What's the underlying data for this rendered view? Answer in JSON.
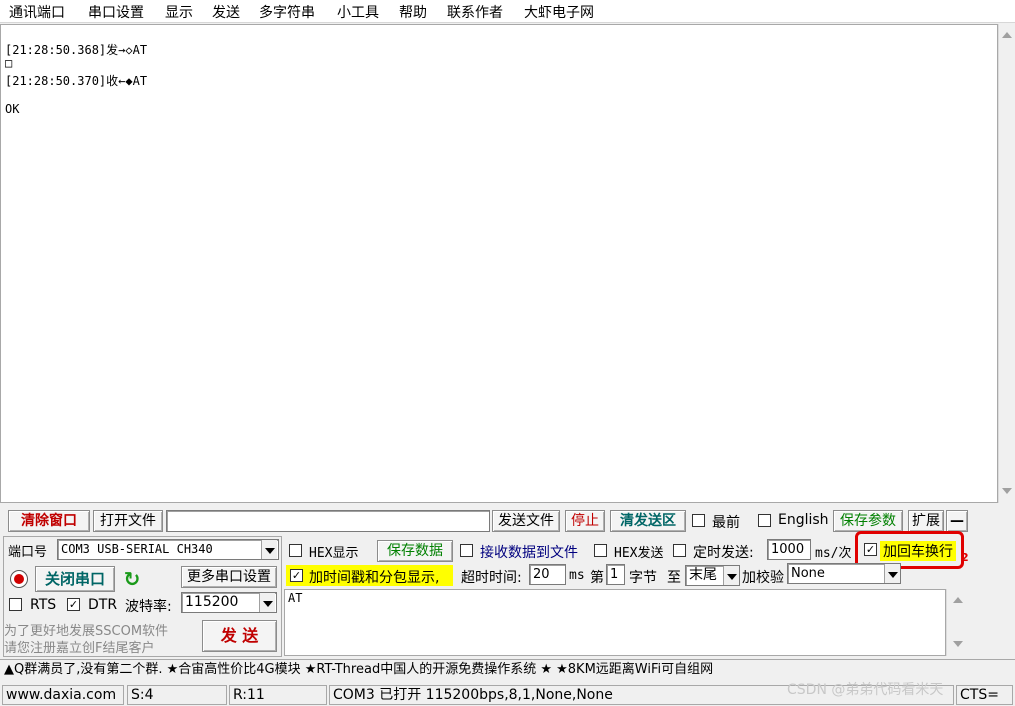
{
  "menu": [
    "通讯端口",
    "串口设置",
    "显示",
    "发送",
    "多字符串",
    "小工具",
    "帮助",
    "联系作者",
    "大虾电子网"
  ],
  "receive": {
    "lines": [
      {
        "text": "[21:28:50.368]发→◇AT"
      },
      {
        "text": "□"
      },
      {
        "text": "[21:28:50.370]收←◆AT"
      },
      {
        "text": ""
      },
      {
        "text": "OK"
      }
    ]
  },
  "toolbar": {
    "clear_window": "清除窗口",
    "open_file": "打开文件",
    "file_path": "",
    "send_file": "发送文件",
    "stop": "停止",
    "clear_send": "清发送区",
    "topmost": "最前",
    "english": "English",
    "save_params": "保存参数",
    "expand": "扩展",
    "collapse": "—"
  },
  "port": {
    "port_label": "端口号",
    "port_value": "COM3 USB-SERIAL CH340",
    "close_port": "关闭串口",
    "more_settings": "更多串口设置",
    "rts": "RTS",
    "dtr": "DTR",
    "baud_label": "波特率:",
    "baud_value": "115200",
    "promo_line1": "为了更好地发展SSCOM软件",
    "promo_line2": "请您注册嘉立创F结尾客户",
    "send_button": "发  送"
  },
  "options": {
    "hex_display": "HEX显示",
    "save_data": "保存数据",
    "recv_to_file": "接收数据到文件",
    "hex_send": "HEX发送",
    "timed_send": "定时发送:",
    "timed_value": "1000",
    "timed_unit": "ms/次",
    "add_crlf": "加回车换行",
    "timestamp": "加时间戳和分包显示,",
    "timeout_label": "超时时间:",
    "timeout_value": "20",
    "timeout_unit": "ms",
    "byte_prefix": "第",
    "byte_value": "1",
    "byte_label": "字节",
    "to_label": "至",
    "end_value": "末尾",
    "checksum_label": "加校验",
    "checksum_value": "None",
    "red_mark": "2"
  },
  "send_area": {
    "text": "AT"
  },
  "ticker": "▲Q群满员了,没有第二个群.  ★合宙高性价比4G模块  ★RT-Thread中国人的开源免费操作系统  ★  ★8KM远距离WiFi可自组网",
  "status": {
    "website": "www.daxia.com",
    "sent": "S:4",
    "received": "R:11",
    "port_status": "COM3 已打开  115200bps,8,1,None,None",
    "watermark": "CSDN @弟弟代码看米天",
    "cts": "CTS="
  },
  "colors": {
    "highlight": "#ffff00",
    "annotation": "#e00000",
    "teal": "#006666"
  }
}
